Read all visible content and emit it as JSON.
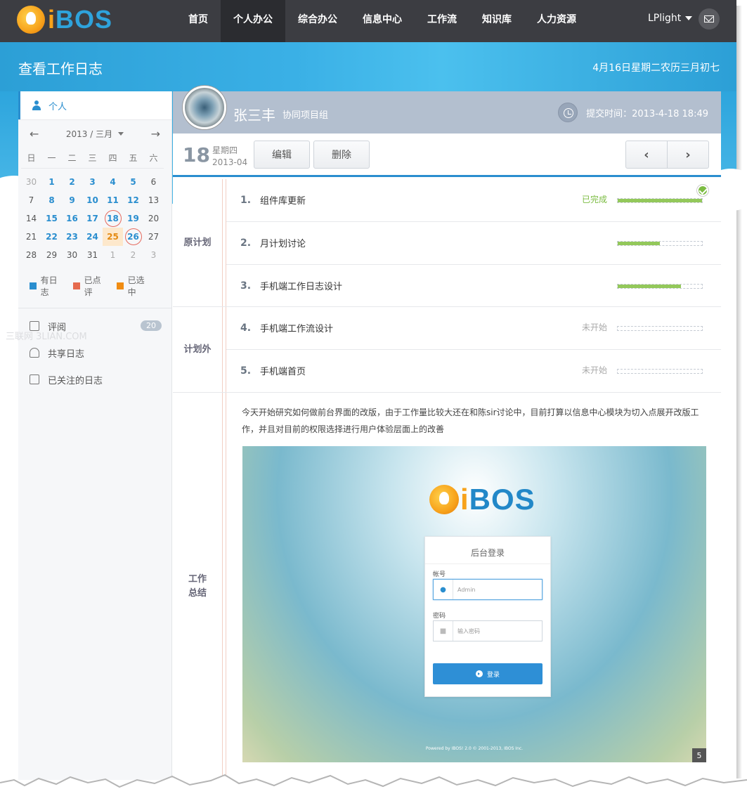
{
  "app": {
    "logo_text_i": "i",
    "logo_text_rest": "BOS"
  },
  "nav": {
    "items": [
      "首页",
      "个人办公",
      "综合办公",
      "信息中心",
      "工作流",
      "知识库",
      "人力资源"
    ],
    "active_index": 1,
    "user": "LPlight"
  },
  "banner": {
    "title": "查看工作日志",
    "date": "4月16日星期二农历三月初七"
  },
  "sidebar": {
    "personal": "个人",
    "calendar": {
      "month": "2013 / 三月",
      "weekdays": [
        "日",
        "一",
        "二",
        "三",
        "四",
        "五",
        "六"
      ],
      "days": [
        [
          "30",
          "1",
          "2",
          "3",
          "4",
          "5",
          "6"
        ],
        [
          "7",
          "8",
          "9",
          "10",
          "11",
          "12",
          "13"
        ],
        [
          "14",
          "15",
          "16",
          "17",
          "18",
          "19",
          "20"
        ],
        [
          "21",
          "22",
          "23",
          "24",
          "25",
          "26",
          "27"
        ],
        [
          "28",
          "29",
          "30",
          "31",
          "1",
          "2",
          "3"
        ]
      ]
    },
    "legend": [
      {
        "label": "有日志",
        "color": "#2a8ecf"
      },
      {
        "label": "已点评",
        "color": "#e56a4e"
      },
      {
        "label": "已选中",
        "color": "#f08c12"
      }
    ],
    "menu": [
      {
        "label": "评阅",
        "badge": "20"
      },
      {
        "label": "共享日志"
      },
      {
        "label": "已关注的日志"
      }
    ],
    "watermark": "三联网 3LIAN.COM"
  },
  "profile": {
    "name": "张三丰",
    "group": "协同项目组",
    "submit_time": "提交时间：2013-4-18 18:49"
  },
  "toolbar": {
    "day": "18",
    "weekday": "星期四",
    "yearmonth": "2013-04",
    "edit_label": "编辑",
    "delete_label": "删除",
    "prev": "‹",
    "next": "›"
  },
  "plan": {
    "original_label": "原计划",
    "extra_label": "计划外",
    "summary_label_1": "工作",
    "summary_label_2": "总结",
    "items": [
      {
        "num": "1.",
        "text": "组件库更新",
        "status": "已完成",
        "progress": 1.0
      },
      {
        "num": "2.",
        "text": "月计划讨论",
        "status": "",
        "progress": 0.5
      },
      {
        "num": "3.",
        "text": "手机端工作日志设计",
        "status": "",
        "progress": 0.75
      },
      {
        "num": "4.",
        "text": "手机端工作流设计",
        "status": "未开始",
        "progress": 0
      },
      {
        "num": "5.",
        "text": "手机端首页",
        "status": "未开始",
        "progress": 0
      }
    ]
  },
  "summary": {
    "text": "今天开始研究如何做前台界面的改版，由于工作量比较大还在和陈sir讨论中，目前打算以信息中心模块为切入点展开改版工作，并且对目前的权限选择进行用户体验层面上的改善"
  },
  "screenshot": {
    "login_title": "后台登录",
    "account_label": "帐号",
    "account_value": "Admin",
    "password_label": "密码",
    "password_placeholder": "输入密码",
    "login_button": "登录",
    "footer": "Powered by IBOS! 2.0 © 2001-2013, IBOS Inc.",
    "page": "5"
  }
}
